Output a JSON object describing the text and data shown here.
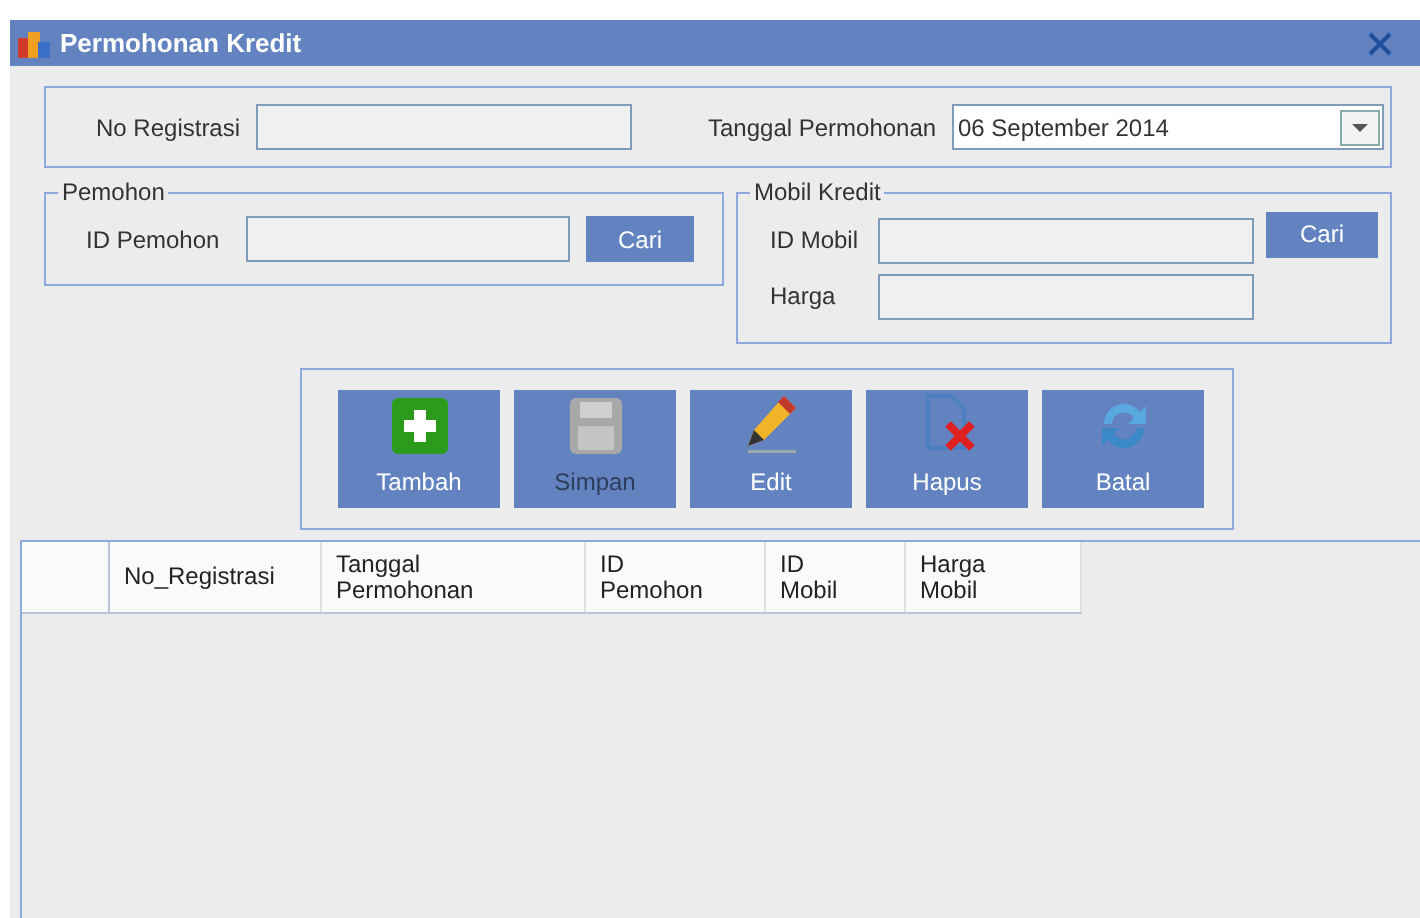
{
  "window": {
    "title": "Permohonan Kredit"
  },
  "header": {
    "no_registrasi": {
      "label": "No Registrasi"
    },
    "tanggal": {
      "label": "Tanggal Permohonan",
      "value": "06 September 2014"
    }
  },
  "pemohon": {
    "title": "Pemohon",
    "id_label": "ID Pemohon",
    "search_button": "Cari"
  },
  "mobil": {
    "title": "Mobil Kredit",
    "id_label": "ID Mobil",
    "harga_label": "Harga",
    "search_button": "Cari"
  },
  "toolbar": [
    {
      "kind": "add",
      "label": "Tambah",
      "disabled": false
    },
    {
      "kind": "save",
      "label": "Simpan",
      "disabled": true
    },
    {
      "kind": "edit",
      "label": "Edit",
      "disabled": false
    },
    {
      "kind": "delete",
      "label": "Hapus",
      "disabled": false
    },
    {
      "kind": "refresh",
      "label": "Batal",
      "disabled": false
    }
  ],
  "table": {
    "columns": [
      "No_Registrasi",
      "Tanggal\nPermohonan",
      "ID\nPemohon",
      "ID\nMobil",
      "Harga\nMobil"
    ]
  }
}
